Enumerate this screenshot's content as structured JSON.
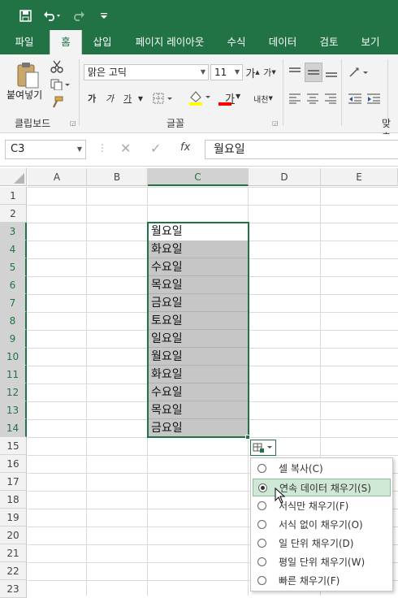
{
  "quick_access": {
    "save": "save-icon",
    "undo": "undo-icon",
    "redo": "redo-icon",
    "customize": "customize-icon"
  },
  "tabs": [
    {
      "label": "파일"
    },
    {
      "label": "홈"
    },
    {
      "label": "삽입"
    },
    {
      "label": "페이지 레이아웃"
    },
    {
      "label": "수식"
    },
    {
      "label": "데이터"
    },
    {
      "label": "검토"
    },
    {
      "label": "보기"
    }
  ],
  "ribbon": {
    "paste_label": "붙여넣기",
    "clipboard_label": "클립보드",
    "font_name": "맑은 고딕",
    "font_size": "11",
    "font_group_label": "글꼴",
    "grow_font": "가",
    "shrink_font": "가",
    "bold": "가",
    "italic": "가",
    "underline": "가",
    "font_color": "가",
    "phonetic": "내천",
    "align_group_label": "맞춤"
  },
  "formula_bar": {
    "name_box": "C3",
    "cancel": "✕",
    "enter": "✓",
    "fx": "fx",
    "formula": "월요일"
  },
  "columns": [
    {
      "label": "A"
    },
    {
      "label": "B"
    },
    {
      "label": "C"
    },
    {
      "label": "D"
    },
    {
      "label": "E"
    }
  ],
  "rows": [
    "1",
    "2",
    "3",
    "4",
    "5",
    "6",
    "7",
    "8",
    "9",
    "10",
    "11",
    "12",
    "13",
    "14",
    "15",
    "16",
    "17",
    "18",
    "19",
    "20",
    "21",
    "22",
    "23"
  ],
  "cells_c": [
    "월요일",
    "화요일",
    "수요일",
    "목요일",
    "금요일",
    "토요일",
    "일요일",
    "월요일",
    "화요일",
    "수요일",
    "목요일",
    "금요일"
  ],
  "autofill_menu": [
    {
      "label": "셀 복사(C)",
      "selected": false
    },
    {
      "label": "연속 데이터 채우기(S)",
      "selected": true
    },
    {
      "label": "서식만 채우기(F)",
      "selected": false
    },
    {
      "label": "서식 없이 채우기(O)",
      "selected": false
    },
    {
      "label": "일 단위 채우기(D)",
      "selected": false
    },
    {
      "label": "평일 단위 채우기(W)",
      "selected": false
    },
    {
      "label": "빠른 채우기(F)",
      "selected": false
    }
  ],
  "colors": {
    "accent": "#217346",
    "selection_fill": "#c6c6c6",
    "menu_active": "#cfe8d6"
  }
}
